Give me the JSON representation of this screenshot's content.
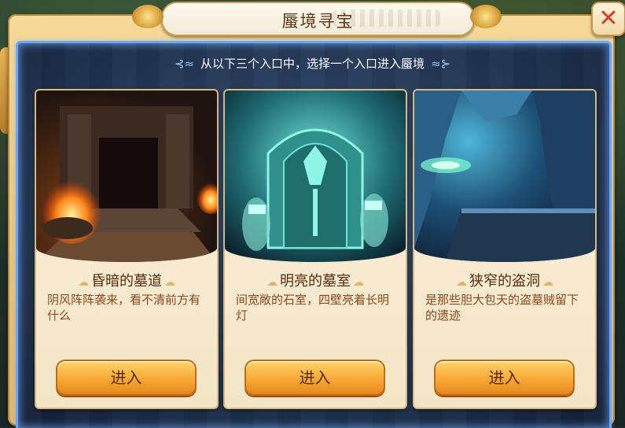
{
  "header": {
    "title": "蜃境寻宝"
  },
  "subtitle": "从以下三个入口中，选择一个入口进入蜃境",
  "cards": [
    {
      "title": "昏暗的墓道",
      "desc": "阴风阵阵袭来，看不清前方有什么",
      "button": "进入"
    },
    {
      "title": "明亮的墓室",
      "desc": "间宽敞的石室，四壁亮着长明灯",
      "button": "进入"
    },
    {
      "title": "狭窄的盗洞",
      "desc": "是那些胆大包天的盗墓贼留下的遗迹",
      "button": "进入"
    }
  ],
  "colors": {
    "frame": "#eec77b",
    "panel_border": "#6aa6ff",
    "button": "#f7a836",
    "close": "#d93b2a"
  },
  "icons": {
    "close": "close-icon",
    "swirl": "swirl-ornament-icon",
    "cloud": "cloud-ornament-icon"
  }
}
